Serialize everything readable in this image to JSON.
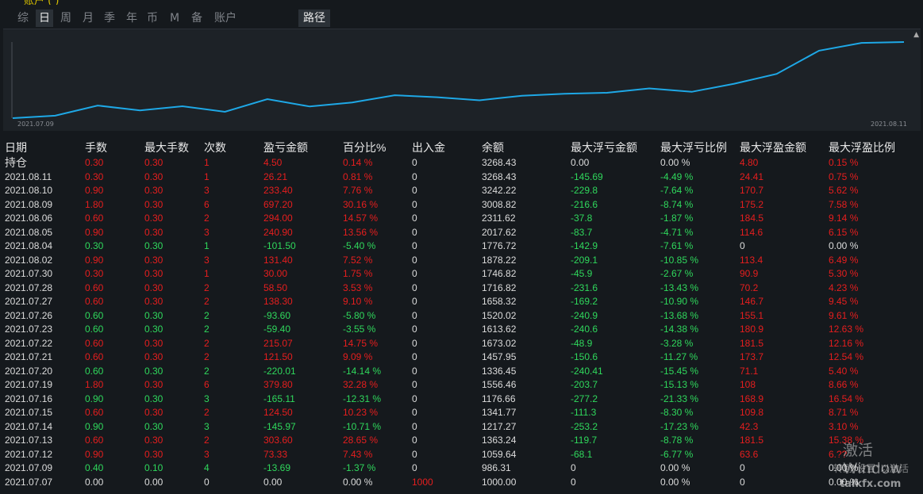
{
  "tabs": [
    "综",
    "日",
    "周",
    "月",
    "季",
    "年",
    "币",
    "M",
    "备",
    "账户"
  ],
  "active_tab": "日",
  "route_tab": "路径",
  "chart": {
    "start_date": "2021.07.09",
    "end_date": "2021.08.11",
    "line_color": "#1ea8e6"
  },
  "columns": [
    "日期",
    "手数",
    "最大手数",
    "次数",
    "盈亏金额",
    "百分比%",
    "出入金",
    "余额",
    "最大浮亏金额",
    "最大浮亏比例",
    "最大浮盈金额",
    "最大浮盈比例"
  ],
  "rows": [
    {
      "date": "持仓",
      "lots": "0.30",
      "max_lots": "0.30",
      "count": "1",
      "pnl": "4.50",
      "pct": "0.14 %",
      "flow": "0",
      "balance": "3268.43",
      "max_float_loss": "0.00",
      "max_float_loss_pct": "0.00 %",
      "max_float_profit": "4.80",
      "max_float_profit_pct": "0.15 %",
      "sign": "pos"
    },
    {
      "date": "2021.08.11",
      "lots": "0.30",
      "max_lots": "0.30",
      "count": "1",
      "pnl": "26.21",
      "pct": "0.81 %",
      "flow": "0",
      "balance": "3268.43",
      "max_float_loss": "-145.69",
      "max_float_loss_pct": "-4.49 %",
      "max_float_profit": "24.41",
      "max_float_profit_pct": "0.75 %",
      "sign": "pos"
    },
    {
      "date": "2021.08.10",
      "lots": "0.90",
      "max_lots": "0.30",
      "count": "3",
      "pnl": "233.40",
      "pct": "7.76 %",
      "flow": "0",
      "balance": "3242.22",
      "max_float_loss": "-229.8",
      "max_float_loss_pct": "-7.64 %",
      "max_float_profit": "170.7",
      "max_float_profit_pct": "5.62 %",
      "sign": "pos"
    },
    {
      "date": "2021.08.09",
      "lots": "1.80",
      "max_lots": "0.30",
      "count": "6",
      "pnl": "697.20",
      "pct": "30.16 %",
      "flow": "0",
      "balance": "3008.82",
      "max_float_loss": "-216.6",
      "max_float_loss_pct": "-8.74 %",
      "max_float_profit": "175.2",
      "max_float_profit_pct": "7.58 %",
      "sign": "pos"
    },
    {
      "date": "2021.08.06",
      "lots": "0.60",
      "max_lots": "0.30",
      "count": "2",
      "pnl": "294.00",
      "pct": "14.57 %",
      "flow": "0",
      "balance": "2311.62",
      "max_float_loss": "-37.8",
      "max_float_loss_pct": "-1.87 %",
      "max_float_profit": "184.5",
      "max_float_profit_pct": "9.14 %",
      "sign": "pos"
    },
    {
      "date": "2021.08.05",
      "lots": "0.90",
      "max_lots": "0.30",
      "count": "3",
      "pnl": "240.90",
      "pct": "13.56 %",
      "flow": "0",
      "balance": "2017.62",
      "max_float_loss": "-83.7",
      "max_float_loss_pct": "-4.71 %",
      "max_float_profit": "114.6",
      "max_float_profit_pct": "6.15 %",
      "sign": "pos"
    },
    {
      "date": "2021.08.04",
      "lots": "0.30",
      "max_lots": "0.30",
      "count": "1",
      "pnl": "-101.50",
      "pct": "-5.40 %",
      "flow": "0",
      "balance": "1776.72",
      "max_float_loss": "-142.9",
      "max_float_loss_pct": "-7.61 %",
      "max_float_profit": "0",
      "max_float_profit_pct": "0.00 %",
      "sign": "neg"
    },
    {
      "date": "2021.08.02",
      "lots": "0.90",
      "max_lots": "0.30",
      "count": "3",
      "pnl": "131.40",
      "pct": "7.52 %",
      "flow": "0",
      "balance": "1878.22",
      "max_float_loss": "-209.1",
      "max_float_loss_pct": "-10.85 %",
      "max_float_profit": "113.4",
      "max_float_profit_pct": "6.49 %",
      "sign": "pos"
    },
    {
      "date": "2021.07.30",
      "lots": "0.30",
      "max_lots": "0.30",
      "count": "1",
      "pnl": "30.00",
      "pct": "1.75 %",
      "flow": "0",
      "balance": "1746.82",
      "max_float_loss": "-45.9",
      "max_float_loss_pct": "-2.67 %",
      "max_float_profit": "90.9",
      "max_float_profit_pct": "5.30 %",
      "sign": "pos"
    },
    {
      "date": "2021.07.28",
      "lots": "0.60",
      "max_lots": "0.30",
      "count": "2",
      "pnl": "58.50",
      "pct": "3.53 %",
      "flow": "0",
      "balance": "1716.82",
      "max_float_loss": "-231.6",
      "max_float_loss_pct": "-13.43 %",
      "max_float_profit": "70.2",
      "max_float_profit_pct": "4.23 %",
      "sign": "pos"
    },
    {
      "date": "2021.07.27",
      "lots": "0.60",
      "max_lots": "0.30",
      "count": "2",
      "pnl": "138.30",
      "pct": "9.10 %",
      "flow": "0",
      "balance": "1658.32",
      "max_float_loss": "-169.2",
      "max_float_loss_pct": "-10.90 %",
      "max_float_profit": "146.7",
      "max_float_profit_pct": "9.45 %",
      "sign": "pos"
    },
    {
      "date": "2021.07.26",
      "lots": "0.60",
      "max_lots": "0.30",
      "count": "2",
      "pnl": "-93.60",
      "pct": "-5.80 %",
      "flow": "0",
      "balance": "1520.02",
      "max_float_loss": "-240.9",
      "max_float_loss_pct": "-13.68 %",
      "max_float_profit": "155.1",
      "max_float_profit_pct": "9.61 %",
      "sign": "neg"
    },
    {
      "date": "2021.07.23",
      "lots": "0.60",
      "max_lots": "0.30",
      "count": "2",
      "pnl": "-59.40",
      "pct": "-3.55 %",
      "flow": "0",
      "balance": "1613.62",
      "max_float_loss": "-240.6",
      "max_float_loss_pct": "-14.38 %",
      "max_float_profit": "180.9",
      "max_float_profit_pct": "12.63 %",
      "sign": "neg"
    },
    {
      "date": "2021.07.22",
      "lots": "0.60",
      "max_lots": "0.30",
      "count": "2",
      "pnl": "215.07",
      "pct": "14.75 %",
      "flow": "0",
      "balance": "1673.02",
      "max_float_loss": "-48.9",
      "max_float_loss_pct": "-3.28 %",
      "max_float_profit": "181.5",
      "max_float_profit_pct": "12.16 %",
      "sign": "pos"
    },
    {
      "date": "2021.07.21",
      "lots": "0.60",
      "max_lots": "0.30",
      "count": "2",
      "pnl": "121.50",
      "pct": "9.09 %",
      "flow": "0",
      "balance": "1457.95",
      "max_float_loss": "-150.6",
      "max_float_loss_pct": "-11.27 %",
      "max_float_profit": "173.7",
      "max_float_profit_pct": "12.54 %",
      "sign": "pos"
    },
    {
      "date": "2021.07.20",
      "lots": "0.60",
      "max_lots": "0.30",
      "count": "2",
      "pnl": "-220.01",
      "pct": "-14.14 %",
      "flow": "0",
      "balance": "1336.45",
      "max_float_loss": "-240.41",
      "max_float_loss_pct": "-15.45 %",
      "max_float_profit": "71.1",
      "max_float_profit_pct": "5.40 %",
      "sign": "neg"
    },
    {
      "date": "2021.07.19",
      "lots": "1.80",
      "max_lots": "0.30",
      "count": "6",
      "pnl": "379.80",
      "pct": "32.28 %",
      "flow": "0",
      "balance": "1556.46",
      "max_float_loss": "-203.7",
      "max_float_loss_pct": "-15.13 %",
      "max_float_profit": "108",
      "max_float_profit_pct": "8.66 %",
      "sign": "pos"
    },
    {
      "date": "2021.07.16",
      "lots": "0.90",
      "max_lots": "0.30",
      "count": "3",
      "pnl": "-165.11",
      "pct": "-12.31 %",
      "flow": "0",
      "balance": "1176.66",
      "max_float_loss": "-277.2",
      "max_float_loss_pct": "-21.33 %",
      "max_float_profit": "168.9",
      "max_float_profit_pct": "16.54 %",
      "sign": "neg"
    },
    {
      "date": "2021.07.15",
      "lots": "0.60",
      "max_lots": "0.30",
      "count": "2",
      "pnl": "124.50",
      "pct": "10.23 %",
      "flow": "0",
      "balance": "1341.77",
      "max_float_loss": "-111.3",
      "max_float_loss_pct": "-8.30 %",
      "max_float_profit": "109.8",
      "max_float_profit_pct": "8.71 %",
      "sign": "pos"
    },
    {
      "date": "2021.07.14",
      "lots": "0.90",
      "max_lots": "0.30",
      "count": "3",
      "pnl": "-145.97",
      "pct": "-10.71 %",
      "flow": "0",
      "balance": "1217.27",
      "max_float_loss": "-253.2",
      "max_float_loss_pct": "-17.23 %",
      "max_float_profit": "42.3",
      "max_float_profit_pct": "3.10 %",
      "sign": "neg"
    },
    {
      "date": "2021.07.13",
      "lots": "0.60",
      "max_lots": "0.30",
      "count": "2",
      "pnl": "303.60",
      "pct": "28.65 %",
      "flow": "0",
      "balance": "1363.24",
      "max_float_loss": "-119.7",
      "max_float_loss_pct": "-8.78 %",
      "max_float_profit": "181.5",
      "max_float_profit_pct": "15.38 %",
      "sign": "pos"
    },
    {
      "date": "2021.07.12",
      "lots": "0.90",
      "max_lots": "0.30",
      "count": "3",
      "pnl": "73.33",
      "pct": "7.43 %",
      "flow": "0",
      "balance": "1059.64",
      "max_float_loss": "-68.1",
      "max_float_loss_pct": "-6.77 %",
      "max_float_profit": "63.6",
      "max_float_profit_pct": "6.??",
      "sign": "pos"
    },
    {
      "date": "2021.07.09",
      "lots": "0.40",
      "max_lots": "0.10",
      "count": "4",
      "pnl": "-13.69",
      "pct": "-1.37 %",
      "flow": "0",
      "balance": "986.31",
      "max_float_loss": "0",
      "max_float_loss_pct": "0.00 %",
      "max_float_profit": "0",
      "max_float_profit_pct": "0.00 %",
      "sign": "neg"
    },
    {
      "date": "2021.07.07",
      "lots": "0.00",
      "max_lots": "0.00",
      "count": "0",
      "pnl": "0.00",
      "pct": "0.00 %",
      "flow": "1000",
      "balance": "1000.00",
      "max_float_loss": "0",
      "max_float_loss_pct": "0.00 %",
      "max_float_profit": "0",
      "max_float_profit_pct": "0.00 %",
      "sign": "zero"
    }
  ],
  "watermark": {
    "line1": "激活 Window",
    "line2": "转到\"设置\"以激活",
    "logo": "talkfx.com"
  }
}
